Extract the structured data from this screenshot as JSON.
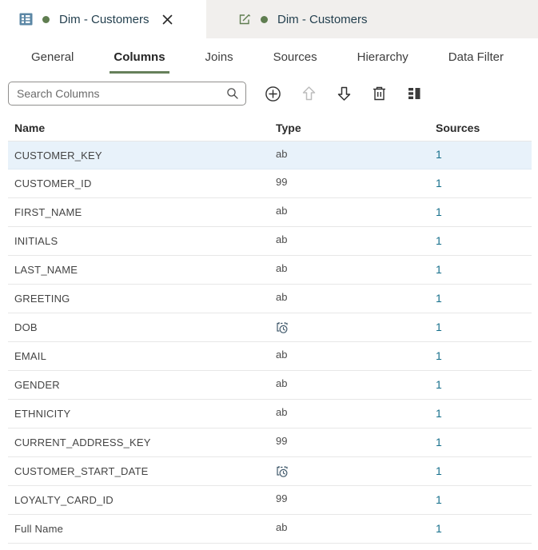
{
  "window_tabs": [
    {
      "label": "Dim - Customers",
      "state": "active",
      "icon": "table-icon",
      "status": "saved"
    },
    {
      "label": "Dim - Customers",
      "state": "inactive",
      "icon": "edit-icon",
      "status": "saved"
    }
  ],
  "nav_tabs": [
    {
      "label": "General",
      "active": false
    },
    {
      "label": "Columns",
      "active": true
    },
    {
      "label": "Joins",
      "active": false
    },
    {
      "label": "Sources",
      "active": false
    },
    {
      "label": "Hierarchy",
      "active": false
    },
    {
      "label": "Data Filter",
      "active": false
    }
  ],
  "toolbar": {
    "search_placeholder": "Search Columns",
    "buttons": [
      {
        "name": "add-column-button",
        "icon": "plus-circle-icon",
        "disabled": false
      },
      {
        "name": "move-up-button",
        "icon": "arrow-up-icon",
        "disabled": true
      },
      {
        "name": "move-down-button",
        "icon": "arrow-down-icon",
        "disabled": false
      },
      {
        "name": "delete-column-button",
        "icon": "trash-icon",
        "disabled": false
      },
      {
        "name": "toggle-detail-panel-button",
        "icon": "panel-icon",
        "disabled": false
      }
    ]
  },
  "table": {
    "headers": [
      "Name",
      "Type",
      "Sources"
    ],
    "rows": [
      {
        "name": "CUSTOMER_KEY",
        "type": "text",
        "type_glyph": "ab",
        "sources": "1",
        "selected": true
      },
      {
        "name": "CUSTOMER_ID",
        "type": "number",
        "type_glyph": "99",
        "sources": "1",
        "selected": false
      },
      {
        "name": "FIRST_NAME",
        "type": "text",
        "type_glyph": "ab",
        "sources": "1",
        "selected": false
      },
      {
        "name": "INITIALS",
        "type": "text",
        "type_glyph": "ab",
        "sources": "1",
        "selected": false
      },
      {
        "name": "LAST_NAME",
        "type": "text",
        "type_glyph": "ab",
        "sources": "1",
        "selected": false
      },
      {
        "name": "GREETING",
        "type": "text",
        "type_glyph": "ab",
        "sources": "1",
        "selected": false
      },
      {
        "name": "DOB",
        "type": "datetime",
        "type_glyph": "",
        "sources": "1",
        "selected": false
      },
      {
        "name": "EMAIL",
        "type": "text",
        "type_glyph": "ab",
        "sources": "1",
        "selected": false
      },
      {
        "name": "GENDER",
        "type": "text",
        "type_glyph": "ab",
        "sources": "1",
        "selected": false
      },
      {
        "name": "ETHNICITY",
        "type": "text",
        "type_glyph": "ab",
        "sources": "1",
        "selected": false
      },
      {
        "name": "CURRENT_ADDRESS_KEY",
        "type": "number",
        "type_glyph": "99",
        "sources": "1",
        "selected": false
      },
      {
        "name": "CUSTOMER_START_DATE",
        "type": "datetime",
        "type_glyph": "",
        "sources": "1",
        "selected": false
      },
      {
        "name": "LOYALTY_CARD_ID",
        "type": "number",
        "type_glyph": "99",
        "sources": "1",
        "selected": false
      },
      {
        "name": "Full Name",
        "type": "text",
        "type_glyph": "ab",
        "sources": "1",
        "selected": false
      }
    ]
  },
  "colors": {
    "tab_underline": "#66805a",
    "status_dot": "#5f7d50",
    "table_icon_blue": "#5b87a5",
    "edit_icon_green": "#5f7d50",
    "source_link": "#17708c",
    "row_highlight": "#e8f2fa",
    "inactive_tab_bg": "#f1efed"
  }
}
